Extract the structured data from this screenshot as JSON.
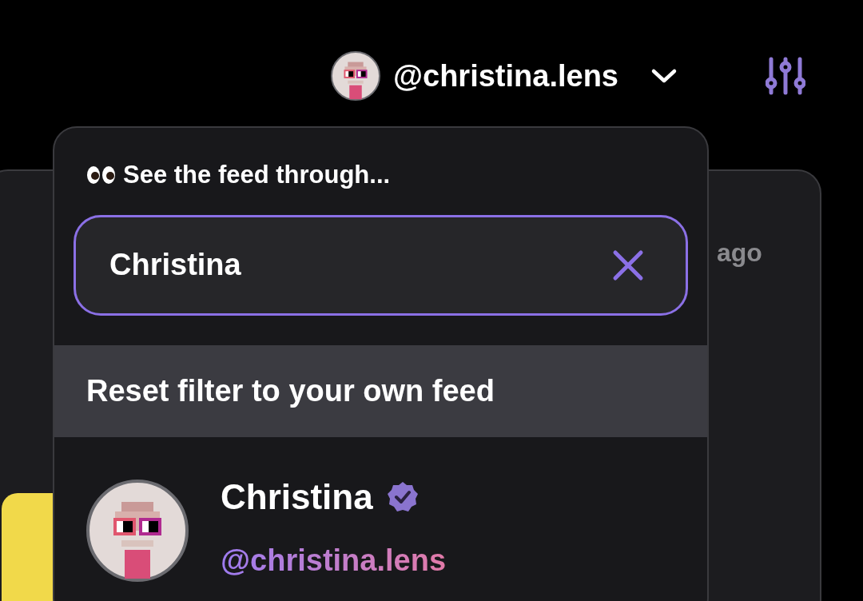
{
  "account": {
    "handle": "@christina.lens"
  },
  "feed_card": {
    "timestamp": "ago"
  },
  "dropdown": {
    "heading": "See the feed through...",
    "search": {
      "value": "Christina"
    },
    "reset": "Reset filter to your own feed",
    "results": [
      {
        "name": "Christina",
        "verified": true,
        "handle": "@christina.lens"
      }
    ]
  }
}
